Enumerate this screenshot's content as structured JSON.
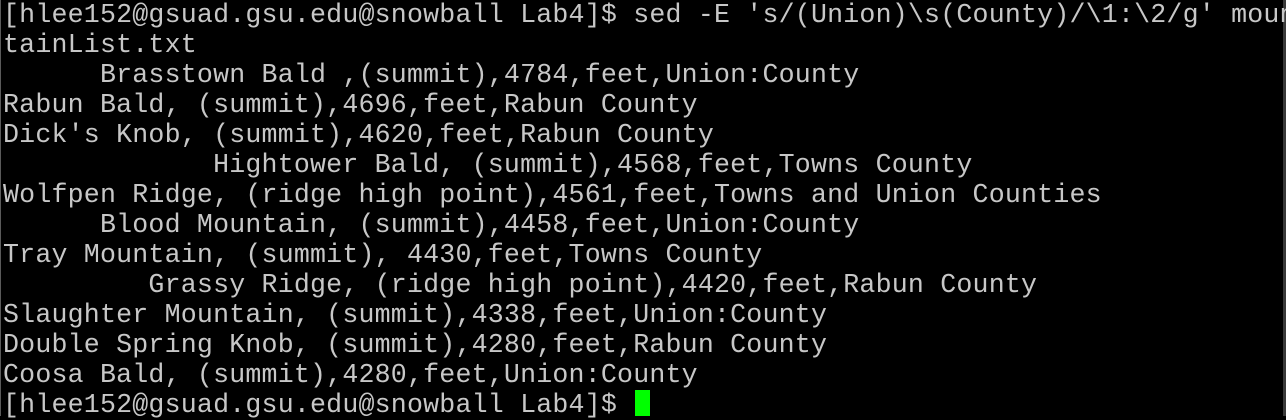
{
  "terminal": {
    "lines": [
      "[hlee152@gsuad.gsu.edu@snowball Lab4]$ sed -E 's/(Union)\\s(County)/\\1:\\2/g' moun",
      "tainList.txt",
      "      Brasstown Bald ,(summit),4784,feet,Union:County",
      "Rabun Bald, (summit),4696,feet,Rabun County",
      "Dick's Knob, (summit),4620,feet,Rabun County",
      "             Hightower Bald, (summit),4568,feet,Towns County",
      "Wolfpen Ridge, (ridge high point),4561,feet,Towns and Union Counties",
      "      Blood Mountain, (summit),4458,feet,Union:County",
      "Tray Mountain, (summit), 4430,feet,Towns County",
      "         Grassy Ridge, (ridge high point),4420,feet,Rabun County",
      "Slaughter Mountain, (summit),4338,feet,Union:County",
      "Double Spring Knob, (summit),4280,feet,Rabun County",
      "Coosa Bald, (summit),4280,feet,Union:County"
    ],
    "prompt": "[hlee152@gsuad.gsu.edu@snowball Lab4]$ ",
    "colors": {
      "background": "#000000",
      "text": "#c7c7c7",
      "cursor": "#00ff00"
    }
  }
}
